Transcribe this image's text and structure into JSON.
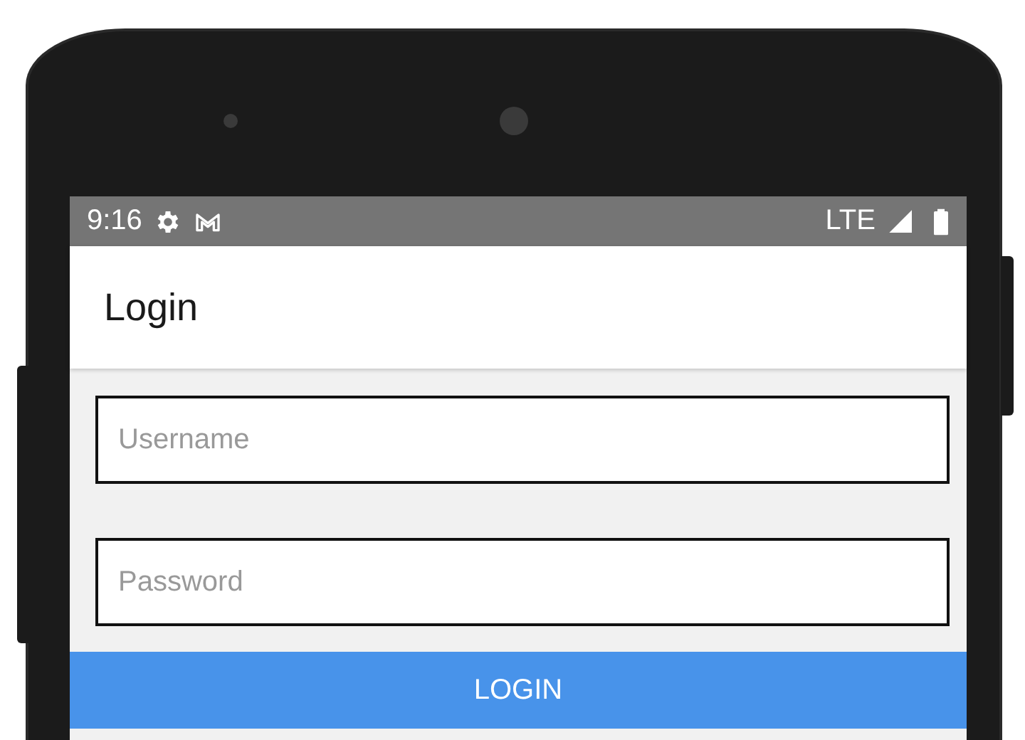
{
  "status_bar": {
    "time": "9:16",
    "network": "LTE"
  },
  "app_bar": {
    "title": "Login"
  },
  "fields": [
    {
      "placeholder": "Username"
    },
    {
      "placeholder": "Password"
    }
  ],
  "buttons": [
    {
      "label": "LOGIN"
    }
  ]
}
